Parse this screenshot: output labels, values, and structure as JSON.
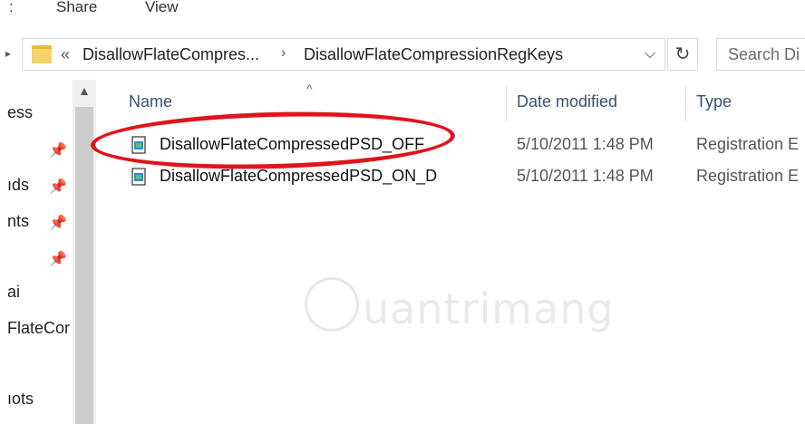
{
  "ribbon": {
    "tabs": [
      ":",
      "Share",
      "View"
    ]
  },
  "address_bar": {
    "back_stub": "▸",
    "overflow": "«",
    "breadcrumbs": [
      "DisallowFlateCompres...",
      "DisallowFlateCompressionRegKeys"
    ],
    "separator": "›",
    "dropdown": "⌵",
    "refresh": "↻"
  },
  "search": {
    "placeholder": "Search Di"
  },
  "nav_pane": {
    "items": [
      {
        "label": "ess",
        "pinned": false
      },
      {
        "label": "",
        "pinned": true
      },
      {
        "label": "ıds",
        "pinned": true
      },
      {
        "label": "nts",
        "pinned": true
      },
      {
        "label": "",
        "pinned": true
      },
      {
        "label": "ai",
        "pinned": false
      },
      {
        "label": "FlateCor",
        "pinned": false
      },
      {
        "label": "ıots",
        "pinned": false
      }
    ],
    "pin_glyph": "📌",
    "scroll_up": "▲"
  },
  "file_list": {
    "sort_indicator": "^",
    "columns": {
      "name": "Name",
      "date": "Date modified",
      "type": "Type"
    },
    "rows": [
      {
        "name": "DisallowFlateCompressedPSD_OFF",
        "date": "5/10/2011 1:48 PM",
        "type": "Registration E",
        "highlighted": true
      },
      {
        "name": "DisallowFlateCompressedPSD_ON_D",
        "date": "5/10/2011 1:48 PM",
        "type": "Registration E",
        "highlighted": false
      }
    ]
  },
  "watermark": {
    "text": "uantrimang"
  },
  "colors": {
    "highlight": "#e0141c",
    "folder": "#f6d26a",
    "header_text": "#3a4f6f"
  }
}
